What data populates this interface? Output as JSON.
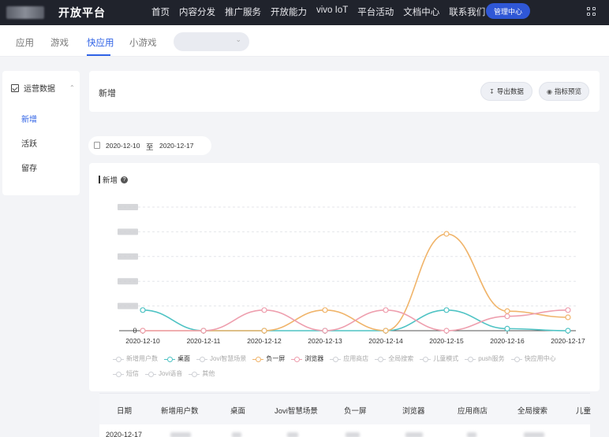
{
  "topbar": {
    "brand": "开放平台",
    "nav": [
      "首页",
      "内容分发",
      "推广服务",
      "开放能力",
      "vivo IoT",
      "平台活动",
      "文档中心",
      "联系我们"
    ],
    "mgmt_button": "管理中心"
  },
  "subtabs": [
    "应用",
    "游戏",
    "快应用",
    "小游戏"
  ],
  "active_subtab": "快应用",
  "sidebar": {
    "header": "运营数据",
    "items": [
      "新增",
      "活跃",
      "留存"
    ],
    "active": "新增"
  },
  "header_card": {
    "title": "新增",
    "export_button": "导出数据",
    "preview_button": "指标预览"
  },
  "date_range": {
    "start": "2020-12-10",
    "separator": "至",
    "end": "2020-12-17"
  },
  "chart_card": {
    "title": "新增",
    "help_icon": "?"
  },
  "chart_data": {
    "type": "line",
    "x": [
      "2020-12-10",
      "2020-12-11",
      "2020-12-12",
      "2020-12-13",
      "2020-12-14",
      "2020-12-15",
      "2020-12-16",
      "2020-12-17"
    ],
    "y_tick_labels_visible": [
      "0"
    ],
    "ylim": [
      0,
      6
    ],
    "grid": true,
    "series": [
      {
        "name": "桌面",
        "color": "#4fc3c4",
        "values": [
          1,
          0,
          0,
          0,
          0,
          1,
          0.1,
          0
        ]
      },
      {
        "name": "负一屏",
        "color": "#f0b46a",
        "values": [
          0,
          0,
          0,
          1,
          0,
          4.7,
          0.95,
          0.65
        ]
      },
      {
        "name": "浏览器",
        "color": "#ee9fae",
        "values": [
          0,
          0,
          1,
          0,
          1,
          0,
          0.7,
          1
        ]
      }
    ],
    "legend": [
      {
        "label": "新增用户数",
        "active": false
      },
      {
        "label": "桌面",
        "active": true
      },
      {
        "label": "Jovi智慧场景",
        "active": false
      },
      {
        "label": "负一屏",
        "active": true
      },
      {
        "label": "浏览器",
        "active": true
      },
      {
        "label": "应用商店",
        "active": false
      },
      {
        "label": "全局搜索",
        "active": false
      },
      {
        "label": "儿童模式",
        "active": false
      },
      {
        "label": "push服务",
        "active": false
      },
      {
        "label": "快应用中心",
        "active": false
      },
      {
        "label": "短信",
        "active": false
      },
      {
        "label": "Jovi语音",
        "active": false
      },
      {
        "label": "其他",
        "active": false
      }
    ],
    "legend_placement": "bottom"
  },
  "table": {
    "headers": [
      "日期",
      "新增用户数",
      "桌面",
      "Jovi智慧场景",
      "负一屏",
      "浏览器",
      "应用商店",
      "全局搜索",
      "儿童"
    ],
    "rows": [
      {
        "date": "2020-12-17"
      }
    ]
  }
}
